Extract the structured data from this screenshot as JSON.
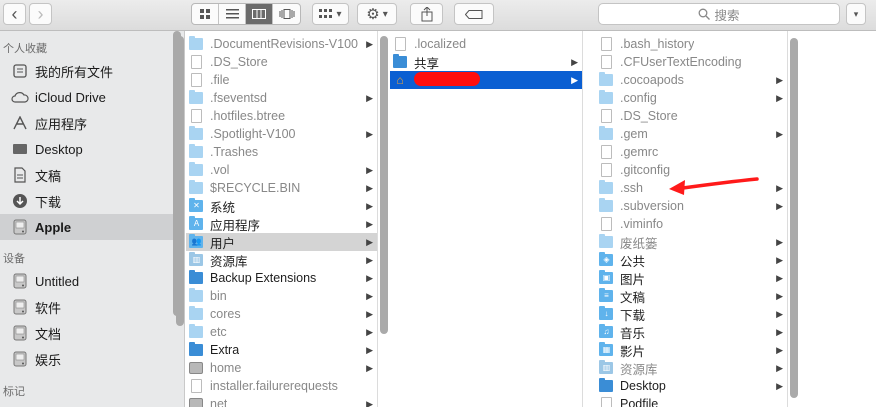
{
  "toolbar": {
    "back_glyph": "‹",
    "forward_glyph": "›",
    "view_modes": [
      "icon-view-icon",
      "list-view-icon",
      "column-view-icon",
      "coverflow-view-icon"
    ],
    "arrange_glyph": "▾",
    "action_glyph": "▾",
    "search_placeholder": "搜索"
  },
  "sidebar": {
    "favorites_header": "个人收藏",
    "favorites": [
      {
        "label": "我的所有文件",
        "icon": "all-files-icon"
      },
      {
        "label": "iCloud Drive",
        "icon": "cloud-icon"
      },
      {
        "label": "应用程序",
        "icon": "applications-icon"
      },
      {
        "label": "Desktop",
        "icon": "desktop-icon"
      },
      {
        "label": "文稿",
        "icon": "documents-icon"
      },
      {
        "label": "下载",
        "icon": "downloads-icon"
      },
      {
        "label": "Apple",
        "icon": "disk-icon",
        "selected": true
      }
    ],
    "devices_header": "设备",
    "devices": [
      {
        "label": "Untitled",
        "icon": "disk-icon"
      },
      {
        "label": "软件",
        "icon": "disk-icon"
      },
      {
        "label": "文档",
        "icon": "disk-icon"
      },
      {
        "label": "娱乐",
        "icon": "disk-icon"
      }
    ],
    "tags_header": "标记"
  },
  "column1": [
    {
      "label": ".DocumentRevisions-V100",
      "type": "folder-light",
      "dim": true,
      "arrow": true
    },
    {
      "label": ".DS_Store",
      "type": "doc",
      "dim": true,
      "arrow": false
    },
    {
      "label": ".file",
      "type": "doc",
      "dim": true,
      "arrow": false
    },
    {
      "label": ".fseventsd",
      "type": "folder-light",
      "dim": true,
      "arrow": true
    },
    {
      "label": ".hotfiles.btree",
      "type": "doc",
      "dim": true,
      "arrow": false
    },
    {
      "label": ".Spotlight-V100",
      "type": "folder-light",
      "dim": true,
      "arrow": true
    },
    {
      "label": ".Trashes",
      "type": "folder-light",
      "dim": true,
      "arrow": false
    },
    {
      "label": ".vol",
      "type": "folder-light",
      "dim": true,
      "arrow": true
    },
    {
      "label": "$RECYCLE.BIN",
      "type": "folder-light",
      "dim": true,
      "arrow": true
    },
    {
      "label": "系统",
      "type": "folder-system",
      "dim": false,
      "arrow": true
    },
    {
      "label": "应用程序",
      "type": "folder-apps",
      "dim": false,
      "arrow": true
    },
    {
      "label": "用户",
      "type": "folder-users",
      "dim": false,
      "arrow": true,
      "selected": true
    },
    {
      "label": "资源库",
      "type": "folder-library",
      "dim": false,
      "arrow": true
    },
    {
      "label": "Backup Extensions",
      "type": "folder",
      "dim": false,
      "arrow": true
    },
    {
      "label": "bin",
      "type": "folder-light",
      "dim": true,
      "arrow": true
    },
    {
      "label": "cores",
      "type": "folder-light",
      "dim": true,
      "arrow": true
    },
    {
      "label": "etc",
      "type": "folder-light",
      "dim": true,
      "arrow": true
    },
    {
      "label": "Extra",
      "type": "folder",
      "dim": false,
      "arrow": true
    },
    {
      "label": "home",
      "type": "disk",
      "dim": true,
      "arrow": true
    },
    {
      "label": "installer.failurerequests",
      "type": "doc",
      "dim": true,
      "arrow": false
    },
    {
      "label": "net",
      "type": "disk",
      "dim": true,
      "arrow": true
    }
  ],
  "column2": [
    {
      "label": ".localized",
      "type": "doc",
      "dim": true,
      "arrow": false
    },
    {
      "label": "共享",
      "type": "folder",
      "dim": false,
      "arrow": true
    },
    {
      "label": "",
      "type": "home",
      "dim": false,
      "arrow": true,
      "selected": true
    }
  ],
  "column3": [
    {
      "label": ".bash_history",
      "type": "doc",
      "dim": true,
      "arrow": false
    },
    {
      "label": ".CFUserTextEncoding",
      "type": "doc",
      "dim": true,
      "arrow": false
    },
    {
      "label": ".cocoapods",
      "type": "folder-light",
      "dim": true,
      "arrow": true
    },
    {
      "label": ".config",
      "type": "folder-light",
      "dim": true,
      "arrow": true
    },
    {
      "label": ".DS_Store",
      "type": "doc",
      "dim": true,
      "arrow": false
    },
    {
      "label": ".gem",
      "type": "folder-light",
      "dim": true,
      "arrow": true
    },
    {
      "label": ".gemrc",
      "type": "doc",
      "dim": true,
      "arrow": false
    },
    {
      "label": ".gitconfig",
      "type": "doc",
      "dim": true,
      "arrow": false
    },
    {
      "label": ".ssh",
      "type": "folder-light",
      "dim": true,
      "arrow": true
    },
    {
      "label": ".subversion",
      "type": "folder-light",
      "dim": true,
      "arrow": true
    },
    {
      "label": ".viminfo",
      "type": "doc",
      "dim": true,
      "arrow": false
    },
    {
      "label": "废纸篓",
      "type": "folder-light",
      "dim": true,
      "arrow": true
    },
    {
      "label": "公共",
      "type": "folder-public",
      "dim": false,
      "arrow": true
    },
    {
      "label": "图片",
      "type": "folder-pictures",
      "dim": false,
      "arrow": true
    },
    {
      "label": "文稿",
      "type": "folder-documents",
      "dim": false,
      "arrow": true
    },
    {
      "label": "下载",
      "type": "folder-downloads",
      "dim": false,
      "arrow": true
    },
    {
      "label": "音乐",
      "type": "folder-music",
      "dim": false,
      "arrow": true
    },
    {
      "label": "影片",
      "type": "folder-movies",
      "dim": false,
      "arrow": true
    },
    {
      "label": "资源库",
      "type": "folder-library",
      "dim": true,
      "arrow": true
    },
    {
      "label": "Desktop",
      "type": "folder-desktop",
      "dim": false,
      "arrow": true
    },
    {
      "label": "Podfile",
      "type": "doc",
      "dim": false,
      "arrow": false
    }
  ],
  "colors": {
    "selection_blue": "#0b5fd2",
    "annotation_red": "#ff1a1a"
  }
}
